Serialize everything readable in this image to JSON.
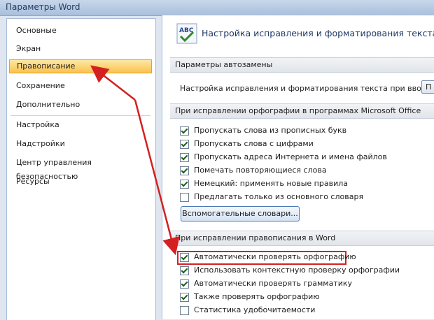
{
  "window": {
    "title": "Параметры Word"
  },
  "sidebar": {
    "items": [
      {
        "label": "Основные"
      },
      {
        "label": "Экран"
      },
      {
        "label": "Правописание"
      },
      {
        "label": "Сохранение"
      },
      {
        "label": "Дополнительно"
      },
      {
        "label": "Настройка"
      },
      {
        "label": "Надстройки"
      },
      {
        "label": "Центр управления безопасностью"
      },
      {
        "label": "Ресурсы"
      }
    ],
    "active": "Правописание"
  },
  "main": {
    "header": "Настройка исправления и форматирования текста.",
    "autocorrect": {
      "section_title": "Параметры автозамены",
      "text": "Настройка исправления и форматирования текста при вводе:",
      "button_label": "П"
    },
    "office": {
      "section_title": "При исправлении орфографии в программах Microsoft Office",
      "options": [
        {
          "label": "Пропускать слова из прописных букв",
          "checked": true
        },
        {
          "label": "Пропускать слова с цифрами",
          "checked": true
        },
        {
          "label": "Пропускать адреса Интернета и имена файлов",
          "checked": true
        },
        {
          "label": "Помечать повторяющиеся слова",
          "checked": true
        },
        {
          "label": "Немецкий: применять новые правила",
          "checked": true
        },
        {
          "label": "Предлагать только из основного словаря",
          "checked": false
        }
      ],
      "dictionaries_button": "Вспомогательные словари..."
    },
    "word": {
      "section_title": "При исправлении правописания в Word",
      "options": [
        {
          "label": "Автоматически проверять орфографию",
          "checked": true
        },
        {
          "label": "Использовать контекстную проверку орфографии",
          "checked": true
        },
        {
          "label": "Автоматически проверять грамматику",
          "checked": true
        },
        {
          "label": "Также проверять орфографию",
          "checked": true
        },
        {
          "label": "Статистика удобочитаемости",
          "checked": false
        }
      ]
    }
  },
  "annotation_color": "#d42020"
}
